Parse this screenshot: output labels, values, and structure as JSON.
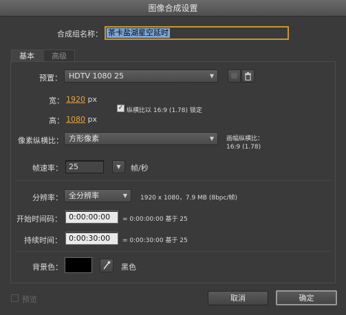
{
  "window": {
    "title": "图像合成设置"
  },
  "comp_name": {
    "label": "合成组名称：",
    "value": "茶卡盐湖星空延时"
  },
  "tabs": [
    {
      "label": "基本"
    },
    {
      "label": "高级"
    }
  ],
  "preset": {
    "label": "预置：",
    "value": "HDTV 1080 25"
  },
  "width": {
    "label": "宽：",
    "value": "1920",
    "unit": "px"
  },
  "height": {
    "label": "高：",
    "value": "1080",
    "unit": "px"
  },
  "lock_aspect": {
    "label": "纵横比以 16:9 (1.78) 锁定",
    "checked": true
  },
  "pixel_aspect": {
    "label": "像素纵横比：",
    "value": "方形像素",
    "frame_aspect_label": "画幅纵横比：",
    "frame_aspect_value": "16:9 (1.78)"
  },
  "frame_rate": {
    "label": "帧速率：",
    "value": "25",
    "unit": "帧/秒"
  },
  "resolution": {
    "label": "分辨率：",
    "value": "全分辨率",
    "info": "1920 x 1080，7.9 MB (8bpc/帧)"
  },
  "start_timecode": {
    "label": "开始时间码：",
    "value": "0:00:00:00",
    "info": "= 0:00:00:00  基于 25"
  },
  "duration": {
    "label": "持续时间：",
    "value": "0:00:30:00",
    "info": "= 0:00:30:00  基于 25"
  },
  "background": {
    "label": "背景色：",
    "color_name": "黑色",
    "color": "#000000"
  },
  "footer": {
    "preview_label": "预览",
    "cancel_label": "取消",
    "ok_label": "确定"
  },
  "icons": {
    "eyedropper": "eyedropper-icon",
    "trash": "trash-icon",
    "save_preset": "save-preset-icon",
    "dropdown_arrow": "chevron-down-icon",
    "check": "check-icon"
  },
  "colors": {
    "accent_orange": "#e8a33a",
    "name_focus": "#c79a2b",
    "selection": "#7da6d9"
  }
}
